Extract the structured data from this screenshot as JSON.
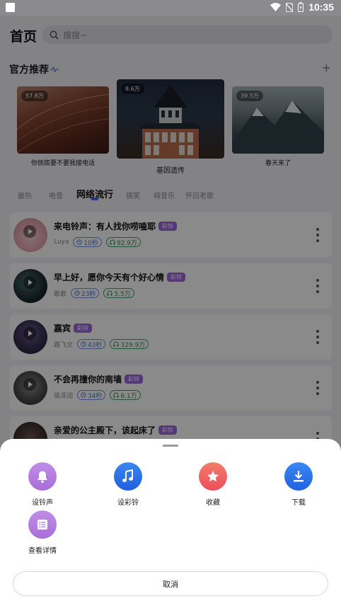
{
  "status_bar": {
    "time": "10:35"
  },
  "header": {
    "title": "首页",
    "search_placeholder": "搜搜~"
  },
  "recommend": {
    "title": "官方推荐",
    "items": [
      {
        "label": "你侧底要不要我接电话",
        "count": "57.8万"
      },
      {
        "label": "基因遗传",
        "count": "8.6万"
      },
      {
        "label": "春天来了",
        "count": "39.5万"
      }
    ]
  },
  "tabs": [
    {
      "label": "最热"
    },
    {
      "label": "电音"
    },
    {
      "label": "网络流行",
      "active": true
    },
    {
      "label": "搞笑"
    },
    {
      "label": "纯音乐"
    },
    {
      "label": "怀旧老歌"
    }
  ],
  "songs": [
    {
      "title": "来电铃声：有人找你唠嗑耶",
      "badge": "彩铃",
      "artist": "Luya",
      "duration": "10秒",
      "plays": "92.9万"
    },
    {
      "title": "早上好，愿你今天有个好心情",
      "badge": "彩铃",
      "artist": "敢敢",
      "duration": "23秒",
      "plays": "5.5万"
    },
    {
      "title": "嘉宾",
      "badge": "彩铃",
      "artist": "路飞文",
      "duration": "43秒",
      "plays": "329.9万"
    },
    {
      "title": "不会再撞你的南墙",
      "badge": "彩铃",
      "artist": "侯泽润",
      "duration": "34秒",
      "plays": "6.1万"
    },
    {
      "title": "亲爱的公主殿下，该起床了",
      "badge": "彩铃"
    }
  ],
  "sheet": {
    "actions": [
      {
        "label": "设铃声",
        "icon": "bell-icon",
        "color": "#b57be0"
      },
      {
        "label": "设彩铃",
        "icon": "music-note-icon",
        "color": "#2d6fe8"
      },
      {
        "label": "收藏",
        "icon": "star-icon",
        "color": "#f06363"
      },
      {
        "label": "下载",
        "icon": "download-icon",
        "color": "#2a74ec"
      },
      {
        "label": "查看详情",
        "icon": "list-icon",
        "color": "#b57be0"
      }
    ],
    "cancel_label": "取消"
  }
}
